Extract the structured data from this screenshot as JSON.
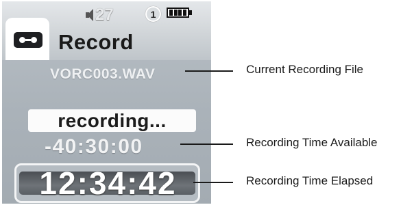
{
  "header": {
    "title": "Record",
    "volume": "27",
    "timer_glyph": "1"
  },
  "file": {
    "name": "VORC003.WAV"
  },
  "status": {
    "text": "recording..."
  },
  "times": {
    "available": "-40:30:00",
    "elapsed": "12:34:42"
  },
  "callouts": {
    "file": "Current Recording File",
    "available": "Recording Time Available",
    "elapsed": "Recording Time Elapsed"
  },
  "colors": {
    "screen": "#aab2b9",
    "elapsed_band": "#5a5f64",
    "label_text": "#1a1a1a"
  },
  "icons": [
    "cassette-icon",
    "speaker-icon",
    "timer-icon",
    "battery-icon"
  ]
}
